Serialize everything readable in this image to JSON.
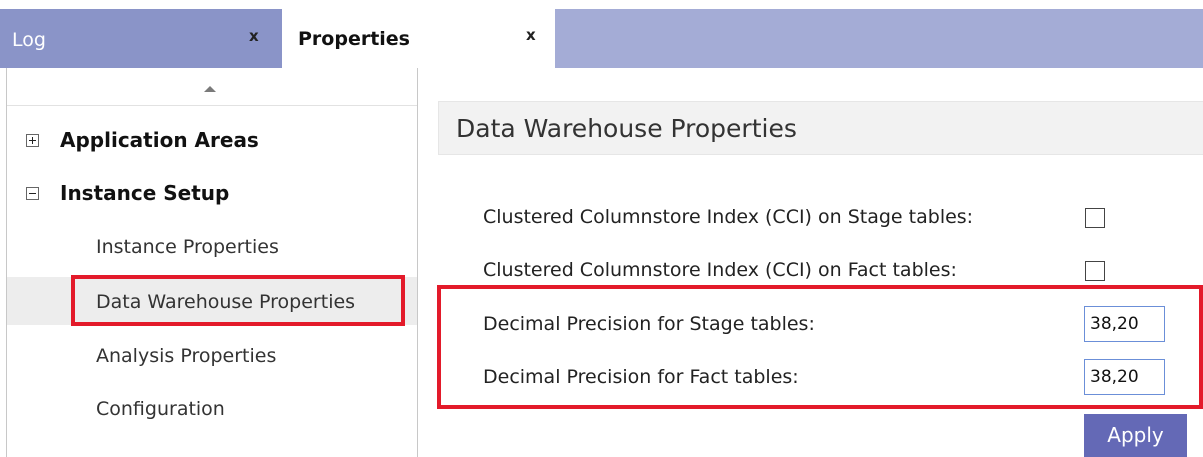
{
  "tabs": [
    {
      "label": "Log",
      "close": "x"
    },
    {
      "label": "Properties",
      "close": "x"
    }
  ],
  "sidebar": {
    "groups": [
      {
        "label": "Application Areas",
        "expander": "plus"
      },
      {
        "label": "Instance Setup",
        "expander": "minus"
      }
    ],
    "items": [
      {
        "label": "Instance Properties"
      },
      {
        "label": "Data Warehouse Properties"
      },
      {
        "label": "Analysis Properties"
      },
      {
        "label": "Configuration"
      }
    ],
    "selected": "Data Warehouse Properties"
  },
  "main": {
    "title": "Data Warehouse Properties",
    "properties": [
      {
        "label": "Clustered Columnstore Index (CCI) on Stage tables:",
        "type": "checkbox",
        "checked": false
      },
      {
        "label": "Clustered Columnstore Index (CCI) on Fact tables:",
        "type": "checkbox",
        "checked": false
      },
      {
        "label": "Decimal Precision for Stage tables:",
        "type": "text",
        "value": "38,20"
      },
      {
        "label": "Decimal Precision for Fact tables:",
        "type": "text",
        "value": "38,20"
      }
    ],
    "apply_label": "Apply"
  },
  "colors": {
    "tab_inactive": "#8a94c8",
    "tab_bar": "#a4acd6",
    "highlight": "#e31a2a",
    "apply_button": "#6469b6"
  }
}
